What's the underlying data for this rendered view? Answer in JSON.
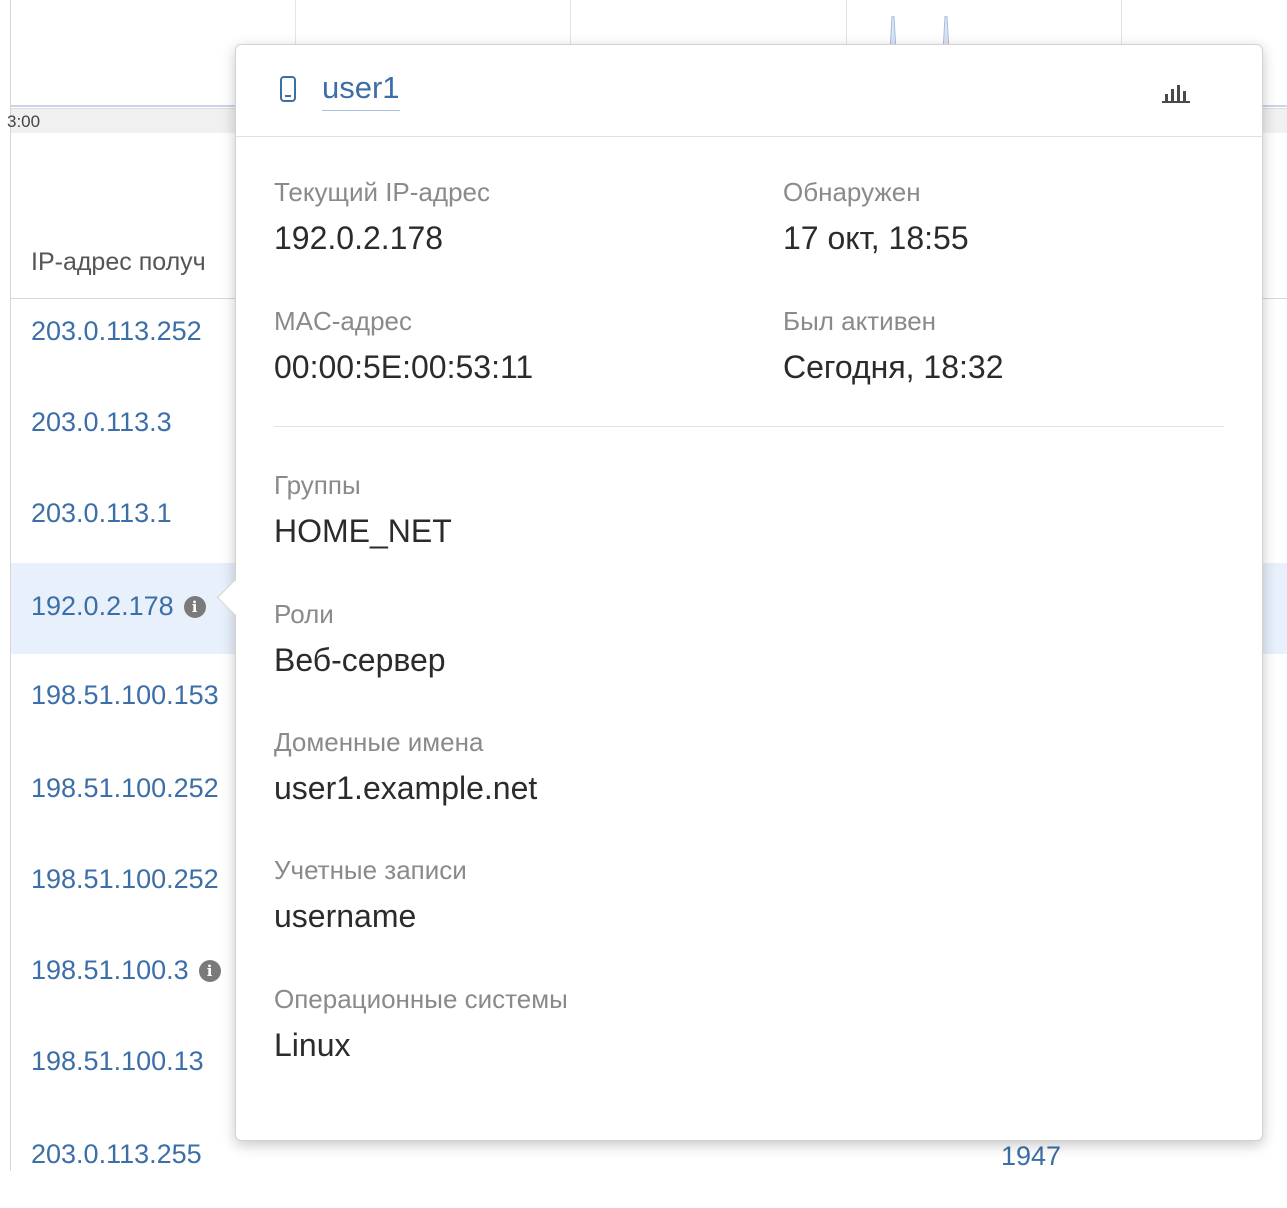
{
  "chart": {
    "axis_label": "3:00",
    "accent_color": "#c9d4ea"
  },
  "table": {
    "header_ip": "IP-адрес получ",
    "rows": [
      {
        "ip": "203.0.113.252",
        "info": false
      },
      {
        "ip": "203.0.113.3",
        "info": false
      },
      {
        "ip": "203.0.113.1",
        "info": false
      },
      {
        "ip": "192.0.2.178",
        "info": true
      },
      {
        "ip": "198.51.100.153",
        "info": false
      },
      {
        "ip": "198.51.100.252",
        "info": false
      },
      {
        "ip": "198.51.100.252",
        "info": false
      },
      {
        "ip": "198.51.100.3",
        "info": true
      },
      {
        "ip": "198.51.100.13",
        "info": false
      },
      {
        "ip": "203.0.113.255",
        "info": false
      }
    ],
    "last_row_count": "1947",
    "info_icon_glyph": "i"
  },
  "popover": {
    "host_name": "user1",
    "host_icon": "device-icon",
    "stats_icon": "bar-chart-icon",
    "current_ip_label": "Текущий IP-адрес",
    "current_ip_value": "192.0.2.178",
    "detected_label": "Обнаружен",
    "detected_value": "17 окт, 18:55",
    "mac_label": "MAC-адрес",
    "mac_value": "00:00:5E:00:53:11",
    "last_active_label": "Был активен",
    "last_active_value": "Сегодня, 18:32",
    "groups_label": "Группы",
    "groups_value": "HOME_NET",
    "roles_label": "Роли",
    "roles_value": "Веб-сервер",
    "domains_label": "Доменные имена",
    "domains_value": "user1.example.net",
    "accounts_label": "Учетные записи",
    "accounts_value": "username",
    "os_label": "Операционные системы",
    "os_value": "Linux"
  },
  "colors": {
    "link": "#3c6ea8",
    "selected_row": "#e7f0fb",
    "label_gray": "#8a8a8a"
  }
}
